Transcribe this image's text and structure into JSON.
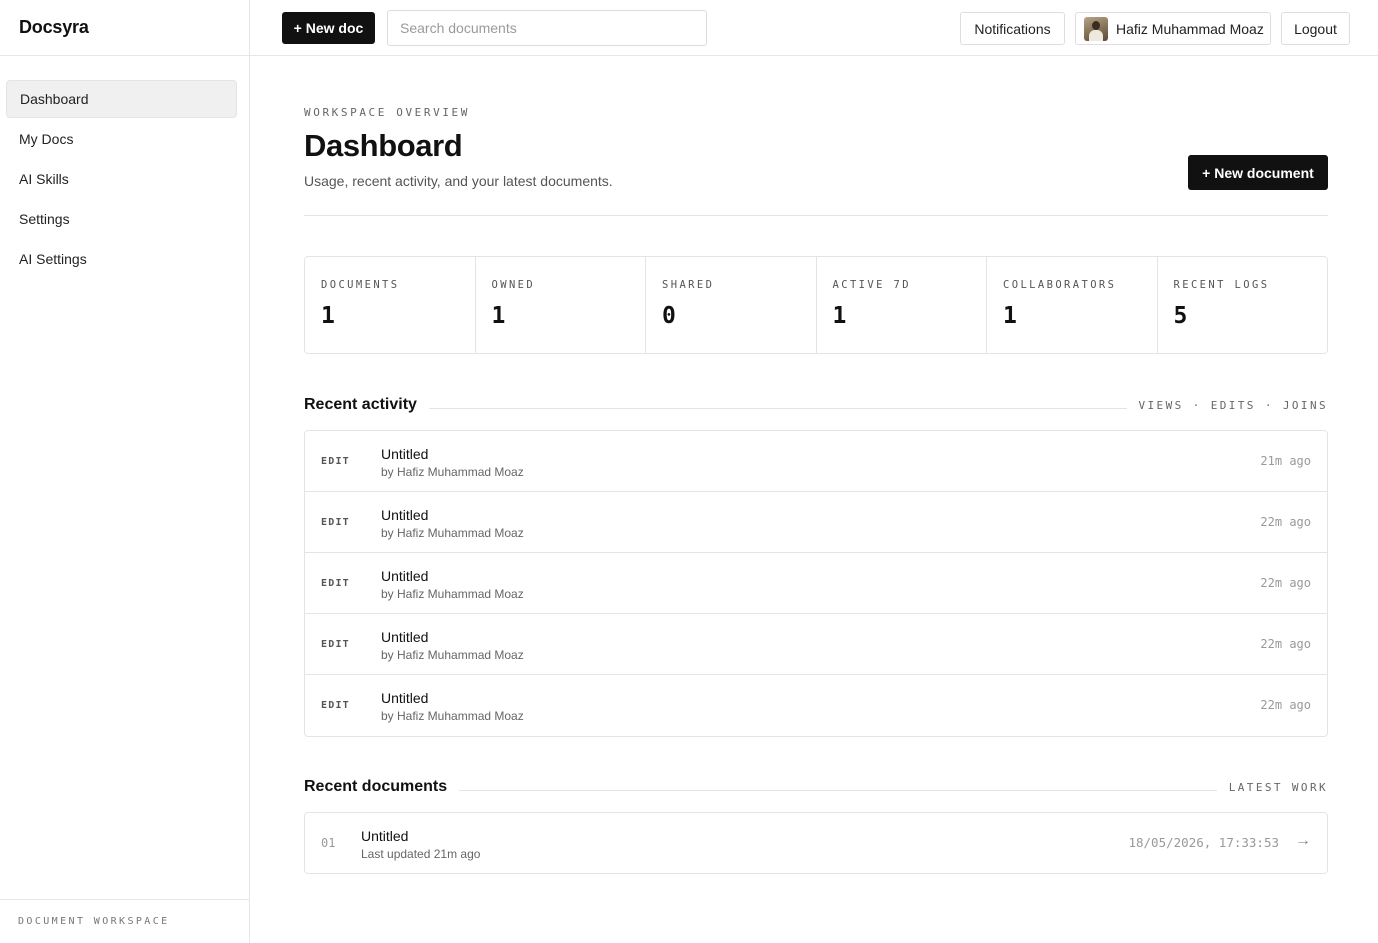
{
  "app": {
    "brand": "Docsyra"
  },
  "sidebar": {
    "items": [
      {
        "label": "Dashboard",
        "active": true
      },
      {
        "label": "My Docs"
      },
      {
        "label": "AI Skills"
      },
      {
        "label": "Settings"
      },
      {
        "label": "AI Settings"
      }
    ],
    "footer": "DOCUMENT WORKSPACE"
  },
  "topbar": {
    "new_doc_label": "+ New doc",
    "search_placeholder": "Search documents",
    "notifications_label": "Notifications",
    "user_name": "Hafiz Muhammad Moaz",
    "logout_label": "Logout"
  },
  "header": {
    "eyebrow": "WORKSPACE OVERVIEW",
    "title": "Dashboard",
    "subtitle": "Usage, recent activity, and your latest documents.",
    "new_document_label": "+ New document"
  },
  "stats": [
    {
      "label": "DOCUMENTS",
      "value": "1"
    },
    {
      "label": "OWNED",
      "value": "1"
    },
    {
      "label": "SHARED",
      "value": "0"
    },
    {
      "label": "ACTIVE 7D",
      "value": "1"
    },
    {
      "label": "COLLABORATORS",
      "value": "1"
    },
    {
      "label": "RECENT LOGS",
      "value": "5"
    }
  ],
  "activity": {
    "title": "Recent activity",
    "meta": "VIEWS · EDITS · JOINS",
    "rows": [
      {
        "kind": "EDIT",
        "title": "Untitled",
        "by": "by Hafiz Muhammad Moaz",
        "time": "21m ago"
      },
      {
        "kind": "EDIT",
        "title": "Untitled",
        "by": "by Hafiz Muhammad Moaz",
        "time": "22m ago"
      },
      {
        "kind": "EDIT",
        "title": "Untitled",
        "by": "by Hafiz Muhammad Moaz",
        "time": "22m ago"
      },
      {
        "kind": "EDIT",
        "title": "Untitled",
        "by": "by Hafiz Muhammad Moaz",
        "time": "22m ago"
      },
      {
        "kind": "EDIT",
        "title": "Untitled",
        "by": "by Hafiz Muhammad Moaz",
        "time": "22m ago"
      }
    ]
  },
  "documents": {
    "title": "Recent documents",
    "meta": "LATEST WORK",
    "rows": [
      {
        "num": "01",
        "title": "Untitled",
        "updated": "Last updated 21m ago",
        "date": "18/05/2026, 17:33:53",
        "arrow": "→"
      }
    ]
  },
  "colors": {
    "accent": "#111111",
    "border": "#e4e4e4",
    "muted": "#999999"
  }
}
